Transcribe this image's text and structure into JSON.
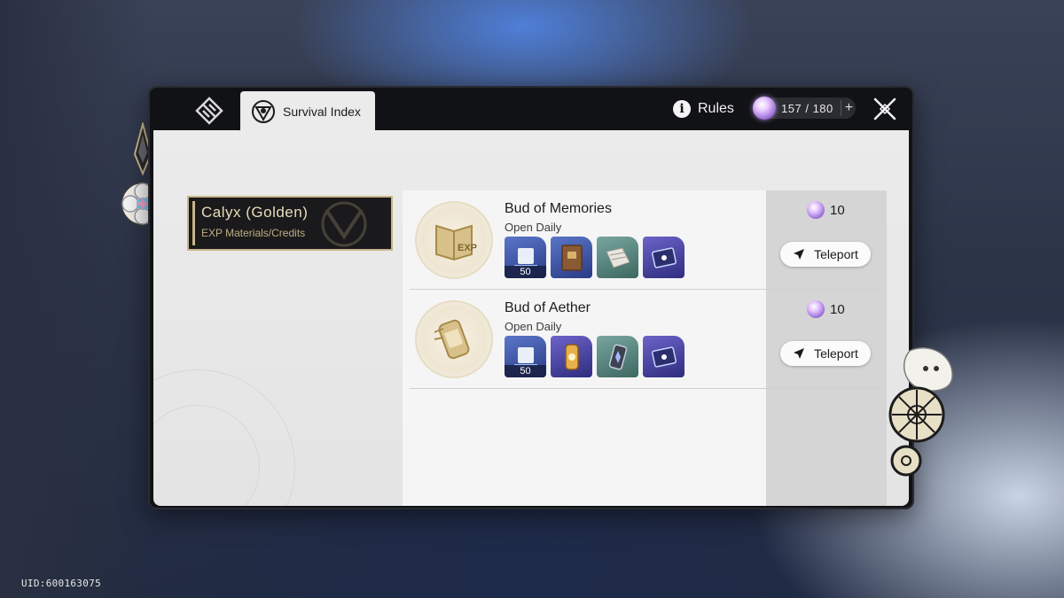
{
  "header": {
    "tab_inactive_icon": "book-diamond-icon",
    "tab_active_label": "Survival Index",
    "rules_label": "Rules",
    "stamina": {
      "current": "157",
      "separator": "/",
      "max": "180",
      "plus": "+"
    }
  },
  "category": {
    "title": "Calyx (Golden)",
    "subtitle": "EXP Materials/Credits"
  },
  "rows": [
    {
      "title": "Bud of Memories",
      "subtitle": "Open Daily",
      "cost": "10",
      "teleport_label": "Teleport",
      "rewards": [
        {
          "icon": "trailblaze-exp-icon",
          "count": "50"
        },
        {
          "icon": "exp-book-icon",
          "count": ""
        },
        {
          "icon": "travel-encounters-icon",
          "count": ""
        },
        {
          "icon": "light-cone-icon",
          "count": ""
        }
      ]
    },
    {
      "title": "Bud of Aether",
      "subtitle": "Open Daily",
      "cost": "10",
      "teleport_label": "Teleport",
      "rewards": [
        {
          "icon": "trailblaze-exp-icon",
          "count": "50"
        },
        {
          "icon": "lost-gold-fragment-icon",
          "count": ""
        },
        {
          "icon": "refined-aether-icon",
          "count": ""
        },
        {
          "icon": "light-cone-icon",
          "count": ""
        }
      ]
    }
  ],
  "footer": {
    "uid": "UID:600163075"
  },
  "colors": {
    "gold": "#c8b68a",
    "panel_dark": "#111216",
    "panel_light": "#ebebeb"
  }
}
